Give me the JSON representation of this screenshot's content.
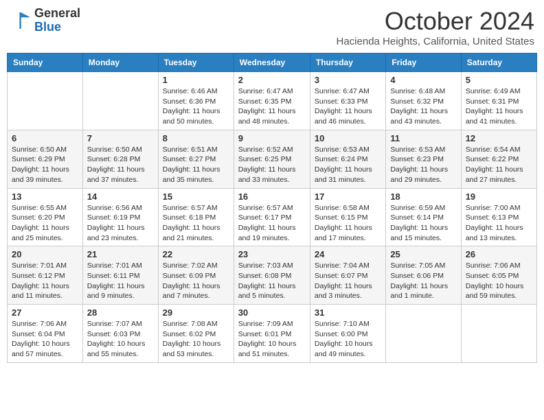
{
  "header": {
    "logo_general": "General",
    "logo_blue": "Blue",
    "month_title": "October 2024",
    "location": "Hacienda Heights, California, United States"
  },
  "days_of_week": [
    "Sunday",
    "Monday",
    "Tuesday",
    "Wednesday",
    "Thursday",
    "Friday",
    "Saturday"
  ],
  "weeks": [
    [
      null,
      null,
      {
        "day": "1",
        "sunrise": "Sunrise: 6:46 AM",
        "sunset": "Sunset: 6:36 PM",
        "daylight": "Daylight: 11 hours and 50 minutes."
      },
      {
        "day": "2",
        "sunrise": "Sunrise: 6:47 AM",
        "sunset": "Sunset: 6:35 PM",
        "daylight": "Daylight: 11 hours and 48 minutes."
      },
      {
        "day": "3",
        "sunrise": "Sunrise: 6:47 AM",
        "sunset": "Sunset: 6:33 PM",
        "daylight": "Daylight: 11 hours and 46 minutes."
      },
      {
        "day": "4",
        "sunrise": "Sunrise: 6:48 AM",
        "sunset": "Sunset: 6:32 PM",
        "daylight": "Daylight: 11 hours and 43 minutes."
      },
      {
        "day": "5",
        "sunrise": "Sunrise: 6:49 AM",
        "sunset": "Sunset: 6:31 PM",
        "daylight": "Daylight: 11 hours and 41 minutes."
      }
    ],
    [
      {
        "day": "6",
        "sunrise": "Sunrise: 6:50 AM",
        "sunset": "Sunset: 6:29 PM",
        "daylight": "Daylight: 11 hours and 39 minutes."
      },
      {
        "day": "7",
        "sunrise": "Sunrise: 6:50 AM",
        "sunset": "Sunset: 6:28 PM",
        "daylight": "Daylight: 11 hours and 37 minutes."
      },
      {
        "day": "8",
        "sunrise": "Sunrise: 6:51 AM",
        "sunset": "Sunset: 6:27 PM",
        "daylight": "Daylight: 11 hours and 35 minutes."
      },
      {
        "day": "9",
        "sunrise": "Sunrise: 6:52 AM",
        "sunset": "Sunset: 6:25 PM",
        "daylight": "Daylight: 11 hours and 33 minutes."
      },
      {
        "day": "10",
        "sunrise": "Sunrise: 6:53 AM",
        "sunset": "Sunset: 6:24 PM",
        "daylight": "Daylight: 11 hours and 31 minutes."
      },
      {
        "day": "11",
        "sunrise": "Sunrise: 6:53 AM",
        "sunset": "Sunset: 6:23 PM",
        "daylight": "Daylight: 11 hours and 29 minutes."
      },
      {
        "day": "12",
        "sunrise": "Sunrise: 6:54 AM",
        "sunset": "Sunset: 6:22 PM",
        "daylight": "Daylight: 11 hours and 27 minutes."
      }
    ],
    [
      {
        "day": "13",
        "sunrise": "Sunrise: 6:55 AM",
        "sunset": "Sunset: 6:20 PM",
        "daylight": "Daylight: 11 hours and 25 minutes."
      },
      {
        "day": "14",
        "sunrise": "Sunrise: 6:56 AM",
        "sunset": "Sunset: 6:19 PM",
        "daylight": "Daylight: 11 hours and 23 minutes."
      },
      {
        "day": "15",
        "sunrise": "Sunrise: 6:57 AM",
        "sunset": "Sunset: 6:18 PM",
        "daylight": "Daylight: 11 hours and 21 minutes."
      },
      {
        "day": "16",
        "sunrise": "Sunrise: 6:57 AM",
        "sunset": "Sunset: 6:17 PM",
        "daylight": "Daylight: 11 hours and 19 minutes."
      },
      {
        "day": "17",
        "sunrise": "Sunrise: 6:58 AM",
        "sunset": "Sunset: 6:15 PM",
        "daylight": "Daylight: 11 hours and 17 minutes."
      },
      {
        "day": "18",
        "sunrise": "Sunrise: 6:59 AM",
        "sunset": "Sunset: 6:14 PM",
        "daylight": "Daylight: 11 hours and 15 minutes."
      },
      {
        "day": "19",
        "sunrise": "Sunrise: 7:00 AM",
        "sunset": "Sunset: 6:13 PM",
        "daylight": "Daylight: 11 hours and 13 minutes."
      }
    ],
    [
      {
        "day": "20",
        "sunrise": "Sunrise: 7:01 AM",
        "sunset": "Sunset: 6:12 PM",
        "daylight": "Daylight: 11 hours and 11 minutes."
      },
      {
        "day": "21",
        "sunrise": "Sunrise: 7:01 AM",
        "sunset": "Sunset: 6:11 PM",
        "daylight": "Daylight: 11 hours and 9 minutes."
      },
      {
        "day": "22",
        "sunrise": "Sunrise: 7:02 AM",
        "sunset": "Sunset: 6:09 PM",
        "daylight": "Daylight: 11 hours and 7 minutes."
      },
      {
        "day": "23",
        "sunrise": "Sunrise: 7:03 AM",
        "sunset": "Sunset: 6:08 PM",
        "daylight": "Daylight: 11 hours and 5 minutes."
      },
      {
        "day": "24",
        "sunrise": "Sunrise: 7:04 AM",
        "sunset": "Sunset: 6:07 PM",
        "daylight": "Daylight: 11 hours and 3 minutes."
      },
      {
        "day": "25",
        "sunrise": "Sunrise: 7:05 AM",
        "sunset": "Sunset: 6:06 PM",
        "daylight": "Daylight: 11 hours and 1 minute."
      },
      {
        "day": "26",
        "sunrise": "Sunrise: 7:06 AM",
        "sunset": "Sunset: 6:05 PM",
        "daylight": "Daylight: 10 hours and 59 minutes."
      }
    ],
    [
      {
        "day": "27",
        "sunrise": "Sunrise: 7:06 AM",
        "sunset": "Sunset: 6:04 PM",
        "daylight": "Daylight: 10 hours and 57 minutes."
      },
      {
        "day": "28",
        "sunrise": "Sunrise: 7:07 AM",
        "sunset": "Sunset: 6:03 PM",
        "daylight": "Daylight: 10 hours and 55 minutes."
      },
      {
        "day": "29",
        "sunrise": "Sunrise: 7:08 AM",
        "sunset": "Sunset: 6:02 PM",
        "daylight": "Daylight: 10 hours and 53 minutes."
      },
      {
        "day": "30",
        "sunrise": "Sunrise: 7:09 AM",
        "sunset": "Sunset: 6:01 PM",
        "daylight": "Daylight: 10 hours and 51 minutes."
      },
      {
        "day": "31",
        "sunrise": "Sunrise: 7:10 AM",
        "sunset": "Sunset: 6:00 PM",
        "daylight": "Daylight: 10 hours and 49 minutes."
      },
      null,
      null
    ]
  ]
}
